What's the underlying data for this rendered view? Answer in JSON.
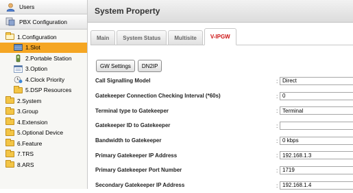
{
  "sidebar": {
    "users_label": "Users",
    "pbx_label": "PBX Configuration",
    "tree": [
      {
        "label": "1.Configuration",
        "icon": "folder-open-icon"
      },
      {
        "label": "1.Slot",
        "icon": "slot-icon",
        "selected": true
      },
      {
        "label": "2.Portable Station",
        "icon": "portable-station-icon"
      },
      {
        "label": "3.Option",
        "icon": "option-icon"
      },
      {
        "label": "4.Clock Priority",
        "icon": "clock-priority-icon"
      },
      {
        "label": "5.DSP Resources",
        "icon": "folder-icon"
      },
      {
        "label": "2.System",
        "icon": "folder-icon"
      },
      {
        "label": "3.Group",
        "icon": "folder-icon"
      },
      {
        "label": "4.Extension",
        "icon": "folder-icon"
      },
      {
        "label": "5.Optional Device",
        "icon": "folder-icon"
      },
      {
        "label": "6.Feature",
        "icon": "folder-icon"
      },
      {
        "label": "7.TRS",
        "icon": "folder-icon"
      },
      {
        "label": "8.ARS",
        "icon": "folder-icon"
      }
    ]
  },
  "main": {
    "title": "System Property",
    "tabs": [
      "Main",
      "System Status",
      "Multisite",
      "V-IPGW"
    ],
    "active_tab": "V-IPGW",
    "buttons": {
      "gw_settings": "GW Settings",
      "dn2ip": "DN2IP"
    },
    "fields": [
      {
        "label": "Call Signalling Model",
        "value": "Direct"
      },
      {
        "label": "Gatekeeper Connection Checking Interval (*60s)",
        "value": "0"
      },
      {
        "label": "Terminal type to Gatekeeper",
        "value": "Terminal"
      },
      {
        "label": "Gatekeeper ID to Gatekeeper",
        "value": ""
      },
      {
        "label": "Bandwidth to Gatekeeper",
        "value": "0 kbps"
      },
      {
        "label": "Primary Gatekeeper IP Address",
        "value": "192.168.1.3"
      },
      {
        "label": "Primary Gatekeeper Port Number",
        "value": "1719"
      },
      {
        "label": "Secondary Gatekeeper IP Address",
        "value": "192.168.1.4"
      }
    ]
  },
  "colors": {
    "accent": "#f5a623",
    "active_tab_text": "#cc1111"
  }
}
